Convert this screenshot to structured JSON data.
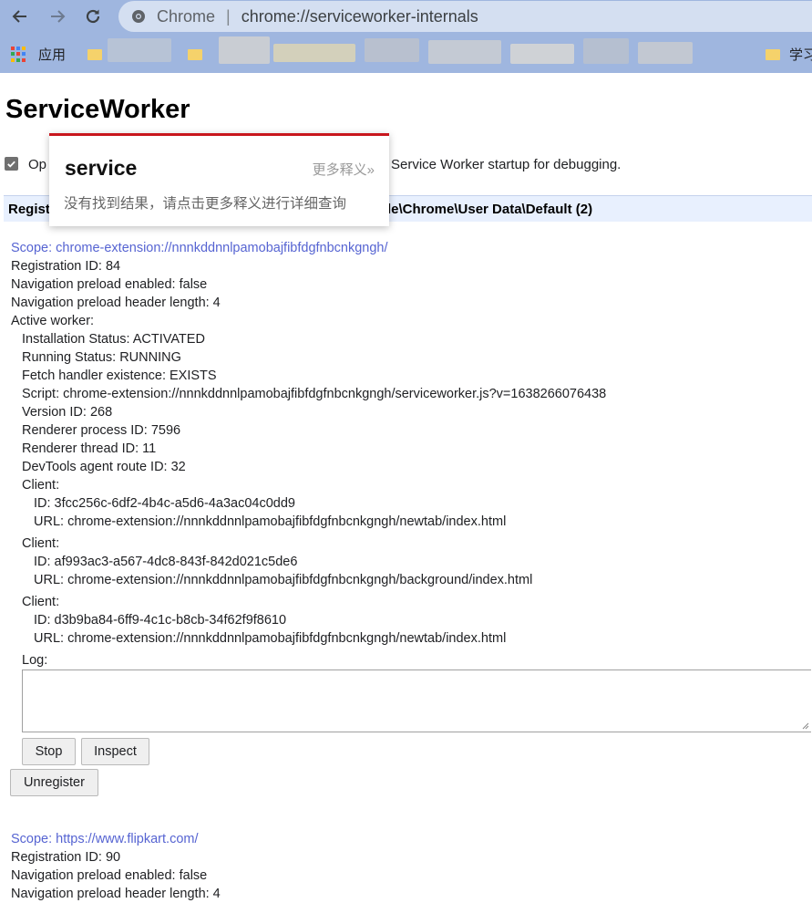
{
  "browser": {
    "omnibox_label": "Chrome",
    "omnibox_separator": "|",
    "url": "chrome://serviceworker-internals",
    "bookmarks": {
      "apps_label": "应用",
      "right_item": "学习"
    }
  },
  "page": {
    "title": "ServiceWorker",
    "option": {
      "checked": true,
      "label_left": "Op",
      "label_right": "Service Worker startup for debugging."
    },
    "registrations_header": {
      "left": "Regist",
      "right": "le\\Chrome\\User Data\\Default (2)"
    }
  },
  "popup": {
    "word": "service",
    "more_link": "更多释义»",
    "message": "没有找到结果，请点击更多释义进行详细查询"
  },
  "registration1": {
    "scope": "Scope: chrome-extension://nnnkddnnlpamobajfibfdgfnbcnkgngh/",
    "registration_id": "Registration ID: 84",
    "nav_preload_enabled": "Navigation preload enabled: false",
    "nav_preload_header_length": "Navigation preload header length: 4",
    "active_worker": "Active worker:",
    "installation_status": "Installation Status: ACTIVATED",
    "running_status": "Running Status: RUNNING",
    "fetch_handler": "Fetch handler existence: EXISTS",
    "script": "Script: chrome-extension://nnnkddnnlpamobajfibfdgfnbcnkgngh/serviceworker.js?v=1638266076438",
    "version_id": "Version ID: 268",
    "renderer_process_id": "Renderer process ID: 7596",
    "renderer_thread_id": "Renderer thread ID: 11",
    "devtools_route_id": "DevTools agent route ID: 32",
    "clients": [
      {
        "heading": "Client:",
        "id": "ID: 3fcc256c-6df2-4b4c-a5d6-4a3ac04c0dd9",
        "url": "URL: chrome-extension://nnnkddnnlpamobajfibfdgfnbcnkgngh/newtab/index.html"
      },
      {
        "heading": "Client:",
        "id": "ID: af993ac3-a567-4dc8-843f-842d021c5de6",
        "url": "URL: chrome-extension://nnnkddnnlpamobajfibfdgfnbcnkgngh/background/index.html"
      },
      {
        "heading": "Client:",
        "id": "ID: d3b9ba84-6ff9-4c1c-b8cb-34f62f9f8610",
        "url": "URL: chrome-extension://nnnkddnnlpamobajfibfdgfnbcnkgngh/newtab/index.html"
      }
    ],
    "log_label": "Log:",
    "log_value": "",
    "stop_label": "Stop",
    "inspect_label": "Inspect",
    "unregister_label": "Unregister"
  },
  "registration2": {
    "scope": "Scope: https://www.flipkart.com/",
    "registration_id": "Registration ID: 90",
    "nav_preload_enabled": "Navigation preload enabled: false",
    "nav_preload_header_length": "Navigation preload header length: 4"
  },
  "colors": {
    "toolbar_bg": "#9fb6df",
    "scope_link": "#5664d2",
    "popup_accent": "#c8161d",
    "header_bg": "#e8f0fe"
  }
}
